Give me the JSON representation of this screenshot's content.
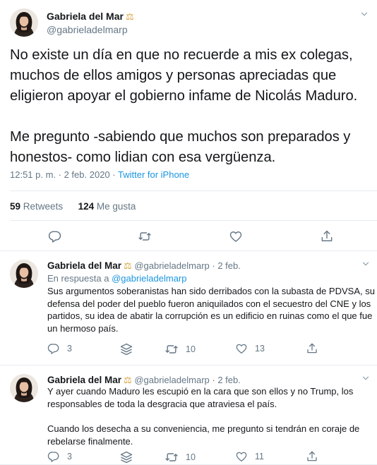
{
  "main_tweet": {
    "author_name": "Gabriela del Mar",
    "author_badge": "⚖",
    "author_handle": "@gabrieladelmarp",
    "paragraphs": [
      "No existe un día en que no recuerde a mis ex colegas, muchos de ellos amigos y personas apreciadas que eligieron apoyar el gobierno infame de Nicolás Maduro.",
      "Me pregunto -sabiendo que muchos son preparados y honestos- como lidian con esa vergüenza."
    ],
    "timestamp": "12:51 p. m. · 2 feb. 2020",
    "separator": " · ",
    "source": "Twitter for iPhone",
    "retweets_count": "59",
    "retweets_label": "Retweets",
    "likes_count": "124",
    "likes_label": "Me gusta",
    "actions": {
      "reply_icon": "reply-icon",
      "retweet_icon": "retweet-icon",
      "like_icon": "heart-icon",
      "share_icon": "share-icon"
    }
  },
  "replies": [
    {
      "author_name": "Gabriela del Mar",
      "author_badge": "⚖",
      "author_handle": "@gabrieladelmarp",
      "date": "2 feb.",
      "dot": " · ",
      "reply_prefix": "En respuesta a ",
      "reply_to": "@gabrieladelmarp",
      "paragraphs": [
        "Sus argumentos soberanistas han sido derribados con la subasta de PDVSA, su defensa del poder del pueblo fueron aniquilados con el secuestro del CNE y los partidos, su idea de abatir la corrupción es un edificio en ruinas como el que fue un hermoso país."
      ],
      "reply_count": "3",
      "retweet_count": "10",
      "like_count": "13"
    },
    {
      "author_name": "Gabriela del Mar",
      "author_badge": "⚖",
      "author_handle": "@gabrieladelmarp",
      "date": "2 feb.",
      "dot": " · ",
      "paragraphs": [
        "Y ayer cuando Maduro les escupió en la cara que son ellos y no Trump, los responsables de toda la desgracia que atraviesa el país.",
        "Cuando los desecha a su conveniencia, me pregunto si tendrán en coraje de rebelarse finalmente."
      ],
      "reply_count": "3",
      "retweet_count": "10",
      "like_count": "11"
    }
  ],
  "colors": {
    "link": "#1b95e0",
    "muted": "#657786",
    "border": "#e6ecf0",
    "badge": "#d8a23a"
  }
}
